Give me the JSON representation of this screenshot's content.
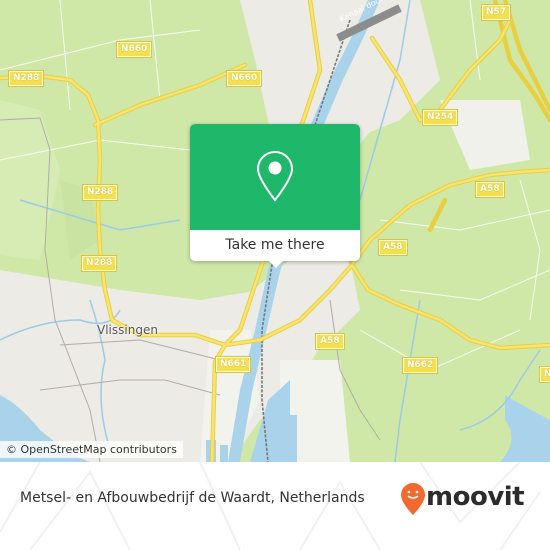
{
  "map": {
    "place_labels": [
      {
        "name": "Vlissingen"
      }
    ],
    "road_labels": [
      "N288",
      "N660",
      "N660",
      "N288",
      "N288",
      "N57",
      "N254",
      "A58",
      "A58",
      "A58",
      "N661",
      "N662",
      "N"
    ],
    "canal_label": "Kanaal door Walcheren",
    "attribution": "© OpenStreetMap contributors"
  },
  "popup": {
    "icon": "location-pin-icon",
    "cta_label": "Take me there",
    "accent_color": "#1fb86a"
  },
  "footer": {
    "place_name": "Metsel- en Afbouwbedrijf de Waardt, Netherlands",
    "brand": "moovit",
    "brand_color": "#f26a2e"
  }
}
